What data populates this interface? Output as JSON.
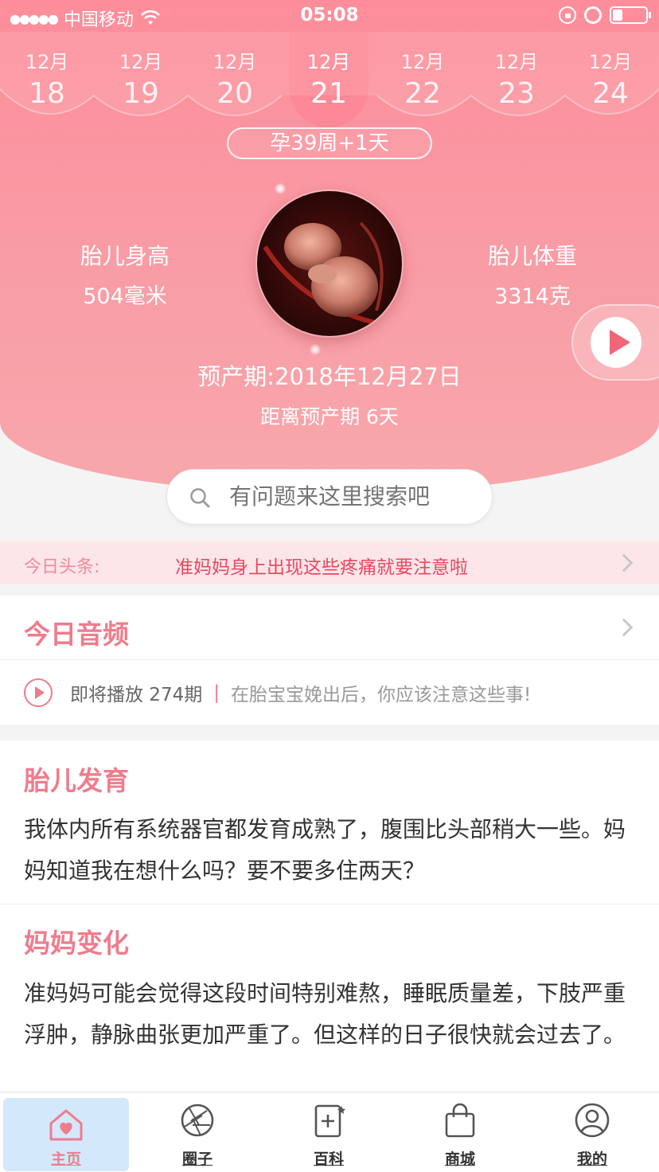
{
  "status_bar": {
    "signal": "●●●●●",
    "carrier": "中国移动",
    "time": "05:08"
  },
  "date_strip": {
    "dates": [
      {
        "month": "12月",
        "day": "18"
      },
      {
        "month": "12月",
        "day": "19"
      },
      {
        "month": "12月",
        "day": "20"
      },
      {
        "month": "12月",
        "day": "21",
        "active": true
      },
      {
        "month": "12月",
        "day": "22"
      },
      {
        "month": "12月",
        "day": "23"
      },
      {
        "month": "12月",
        "day": "24"
      }
    ]
  },
  "pregnancy_week": "孕39周+1天",
  "fetal_height": {
    "label": "胎儿身高",
    "value": "504毫米"
  },
  "fetal_weight": {
    "label": "胎儿体重",
    "value": "3314克"
  },
  "due_date": "预产期:2018年12月27日",
  "due_remaining": "距离预产期 6天",
  "search": {
    "placeholder": "有问题来这里搜索吧"
  },
  "headline": {
    "tag": "今日头条:",
    "text": "准妈妈身上出现这些疼痛就要注意啦"
  },
  "audio": {
    "title": "今日音频",
    "upcoming": "即将播放 274期",
    "separator": "|",
    "description": "在胎宝宝娩出后，你应该注意这些事!"
  },
  "fetal_dev": {
    "title": "胎儿发育",
    "text": "我体内所有系统器官都发育成熟了，腹围比头部稍大一些。妈妈知道我在想什么吗？要不要多住两天？"
  },
  "mom_change": {
    "title": "妈妈变化",
    "text": "准妈妈可能会觉得这段时间特别难熬，睡眠质量差，下肢严重浮肿，静脉曲张更加严重了。但这样的日子很快就会过去了。"
  },
  "tabbar": {
    "tabs": [
      {
        "label": "主页",
        "icon": "home-heart-icon",
        "active": true
      },
      {
        "label": "圈子",
        "icon": "aperture-icon"
      },
      {
        "label": "百科",
        "icon": "encyclopedia-icon"
      },
      {
        "label": "商城",
        "icon": "shopping-bag-icon"
      },
      {
        "label": "我的",
        "icon": "profile-icon"
      }
    ]
  },
  "colors": {
    "header_pink": "#fd8d9a",
    "accent": "#ef7c8c",
    "headline_bg": "#fde6ea",
    "headline_text": "#e8485f",
    "active_tab_bg": "#d4e8fb"
  }
}
